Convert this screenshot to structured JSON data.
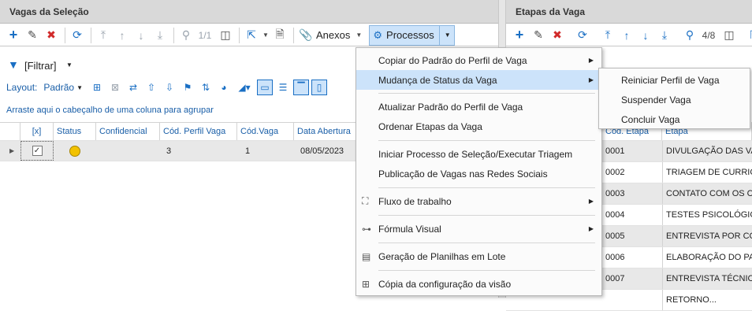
{
  "left_panel": {
    "title": "Vagas da Seleção",
    "toolbar": {
      "page_indicator": "1/1",
      "anexos_label": "Anexos",
      "processos_label": "Processos"
    },
    "filter_label": "[Filtrar]",
    "layout_label": "Layout:",
    "layout_value": "Padrão",
    "group_hint": "Arraste aqui o cabeçalho de uma coluna para agrupar",
    "columns": [
      "[x]",
      "Status",
      "Confidencial",
      "Cód. Perfil Vaga",
      "Cód.Vaga",
      "Data Abertura"
    ],
    "rows": [
      {
        "checked": true,
        "cod_perfil": "3",
        "cod_vaga": "1",
        "data_abertura": "08/05/2023"
      }
    ]
  },
  "right_panel": {
    "title": "Etapas da Vaga",
    "page_indicator": "4/8",
    "columns": [
      "Cód. Etapa",
      "Etapa"
    ],
    "rows": [
      {
        "codigo": "0001",
        "etapa": "DIVULGAÇÃO DAS VA..."
      },
      {
        "codigo": "0002",
        "etapa": "TRIAGEM DE CURRICU..."
      },
      {
        "codigo": "0003",
        "etapa": "CONTATO COM OS CA..."
      },
      {
        "codigo": "0004",
        "etapa": "TESTES PSICOLÓGIC..."
      },
      {
        "codigo": "0005",
        "etapa": "ENTREVISTA POR CO..."
      },
      {
        "codigo": "0006",
        "etapa": "ELABORAÇÃO DO PAR..."
      },
      {
        "codigo": "0007",
        "etapa": "ENTREVISTA TÉCNICA..."
      },
      {
        "codigo": "",
        "etapa": "RETORNO..."
      }
    ]
  },
  "processos_menu": {
    "items": [
      {
        "label": "Copiar do Padrão do Perfil de Vaga",
        "submenu": true
      },
      {
        "label": "Mudança de Status da Vaga",
        "submenu": true,
        "highlighted": true
      },
      {
        "label": "Atualizar Padrão do Perfil de Vaga"
      },
      {
        "label": "Ordenar Etapas da Vaga"
      },
      {
        "label": "Iniciar Processo de Seleção/Executar Triagem"
      },
      {
        "label": "Publicação de Vagas nas Redes Sociais"
      },
      {
        "label": "Fluxo de trabalho",
        "submenu": true
      },
      {
        "label": "Fórmula Visual",
        "submenu": true
      },
      {
        "label": "Geração de Planilhas em Lote"
      },
      {
        "label": "Cópia da configuração da visão"
      }
    ]
  },
  "status_submenu": {
    "items": [
      "Reiniciar Perfil de Vaga",
      "Suspender Vaga",
      "Concluir Vaga"
    ]
  },
  "colors": {
    "accent": "#1a6fc4",
    "menu_highlight": "#cce3fa",
    "selected_row": "#e8e8e8",
    "status_yellow": "#f2c200"
  }
}
